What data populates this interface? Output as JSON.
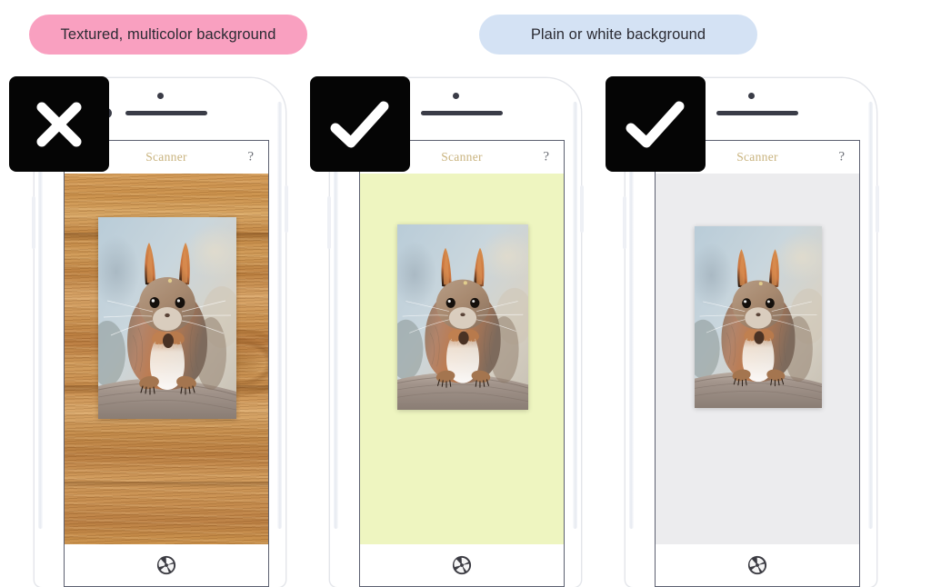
{
  "labels": {
    "bad": {
      "text": "Textured, multicolor background",
      "bg": "#f9a0c0",
      "fg": "#2b2b33"
    },
    "good": {
      "text": "Plain or white background",
      "bg": "#d4e2f4",
      "fg": "#2b2b33"
    }
  },
  "badges": [
    {
      "icon": "cross-icon",
      "meaning": "incorrect",
      "bg": "#050505",
      "fg": "#ffffff"
    },
    {
      "icon": "check-icon",
      "meaning": "correct",
      "bg": "#050505",
      "fg": "#ffffff"
    },
    {
      "icon": "check-icon",
      "meaning": "correct",
      "bg": "#050505",
      "fg": "#ffffff"
    }
  ],
  "app": {
    "title": "Scanner",
    "title_color": "#c9b37e",
    "menu_icon": "hamburger-icon",
    "help_label": "?",
    "shutter_icon": "camera-aperture-icon"
  },
  "phones": [
    {
      "id": "phone-incorrect",
      "background_name": "wood-texture",
      "background_color": "#c58a44",
      "verdict": "incorrect",
      "photo_subject": "red squirrel"
    },
    {
      "id": "phone-correct-yellow",
      "background_name": "plain-pale-yellow",
      "background_color": "#eef5c0",
      "verdict": "correct",
      "photo_subject": "red squirrel"
    },
    {
      "id": "phone-correct-white",
      "background_name": "plain-light-grey",
      "background_color": "#ececee",
      "verdict": "correct",
      "photo_subject": "red squirrel"
    }
  ],
  "device": {
    "frame_color": "#ffffff",
    "screen_border_color": "#5c6070",
    "sensor_color": "#3a3c47"
  }
}
